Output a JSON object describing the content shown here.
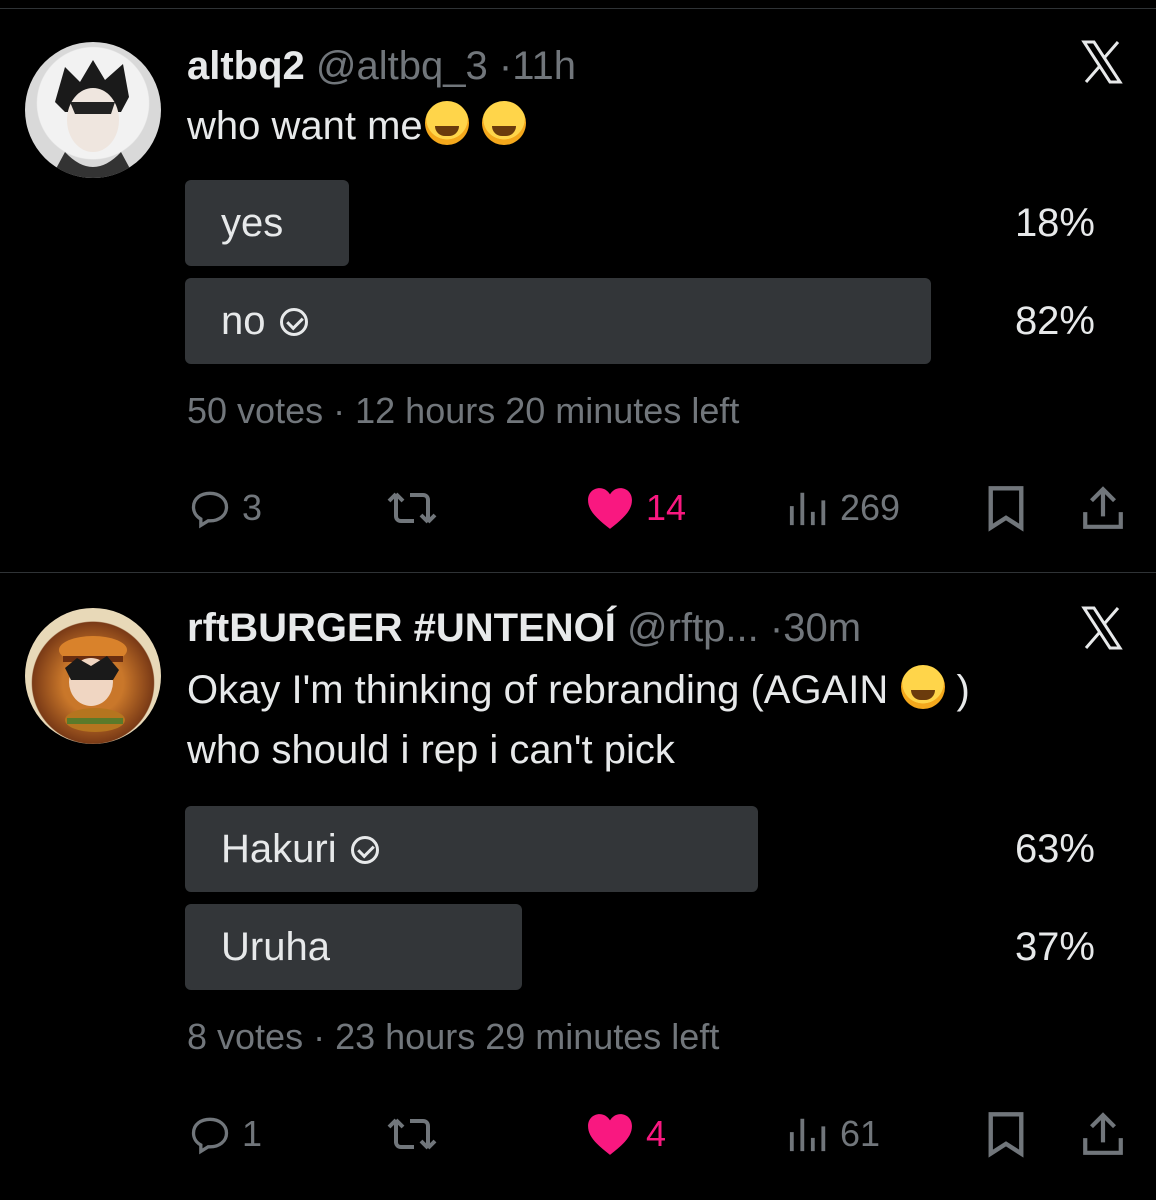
{
  "posts": [
    {
      "author": "altbq2",
      "handle": "@altbq_3",
      "time": "11h",
      "text": "who want me",
      "poll": {
        "options": [
          {
            "label": "yes",
            "percent": "18%",
            "fraction": 0.18,
            "selected": false
          },
          {
            "label": "no",
            "percent": "82%",
            "fraction": 0.82,
            "selected": true
          }
        ],
        "votes": "50 votes",
        "time_left": "12 hours 20 minutes left"
      },
      "actions": {
        "replies": "3",
        "likes": "14",
        "views": "269"
      }
    },
    {
      "author": "rftBURGER #UNTENOÍ",
      "handle": "@rftp...",
      "time": "30m",
      "text_line1": "Okay I'm thinking of rebranding (AGAIN",
      "text_line1_end": ")",
      "text_line2": "who should i rep i can't pick",
      "poll": {
        "options": [
          {
            "label": "Hakuri",
            "percent": "63%",
            "fraction": 0.63,
            "selected": true
          },
          {
            "label": "Uruha",
            "percent": "37%",
            "fraction": 0.37,
            "selected": false
          }
        ],
        "votes": "8 votes",
        "time_left": "23 hours 29 minutes left"
      },
      "actions": {
        "replies": "1",
        "likes": "4",
        "views": "61"
      }
    }
  ],
  "separator": "·",
  "colors": {
    "background": "#000000",
    "text": "#e7e9ea",
    "muted": "#71767b",
    "bar": "#333639",
    "like": "#f91880"
  }
}
